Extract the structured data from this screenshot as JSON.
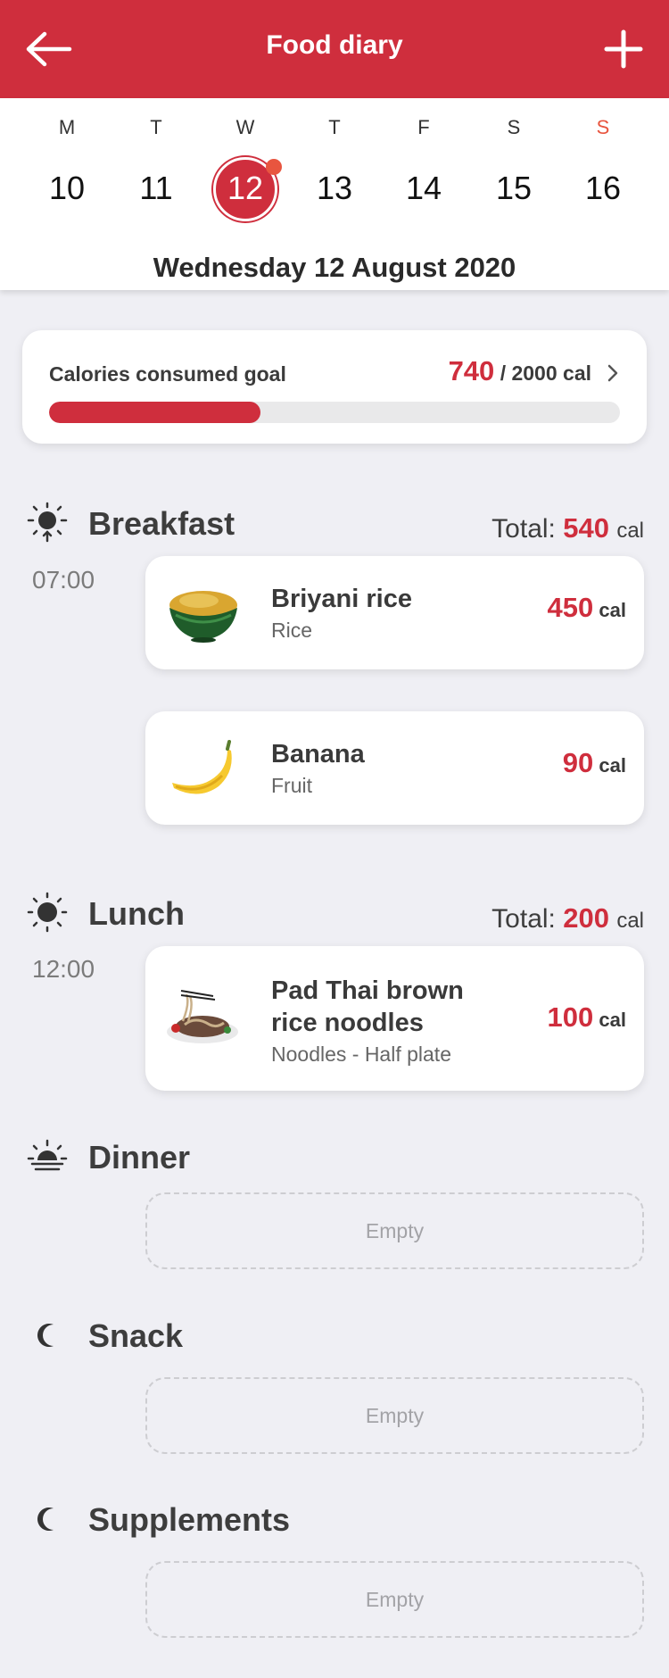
{
  "header": {
    "title": "Food diary",
    "back_icon": "arrow-left-icon",
    "add_icon": "plus-icon"
  },
  "calendar": {
    "days": [
      {
        "weekday": "M",
        "date": "10"
      },
      {
        "weekday": "T",
        "date": "11"
      },
      {
        "weekday": "W",
        "date": "12"
      },
      {
        "weekday": "T",
        "date": "13"
      },
      {
        "weekday": "F",
        "date": "14"
      },
      {
        "weekday": "S",
        "date": "15"
      },
      {
        "weekday": "S",
        "date": "16"
      }
    ],
    "selected_date": "12",
    "full_date": "Wednesday 12 August 2020"
  },
  "goal": {
    "label": "Calories consumed goal",
    "consumed": "740",
    "target_text": "/ 2000 cal",
    "progress_fraction": 0.37
  },
  "meals": {
    "breakfast": {
      "title": "Breakfast",
      "total_label": "Total:",
      "total_value": "540",
      "unit": "cal",
      "time": "07:00",
      "items": [
        {
          "name": "Briyani rice",
          "category": "Rice",
          "calories": "450",
          "unit": "cal"
        },
        {
          "name": "Banana",
          "category": "Fruit",
          "calories": "90",
          "unit": "cal"
        }
      ]
    },
    "lunch": {
      "title": "Lunch",
      "total_label": "Total:",
      "total_value": "200",
      "unit": "cal",
      "time": "12:00",
      "items": [
        {
          "name_line1": "Pad Thai brown",
          "name_line2": "rice noodles",
          "category": "Noodles - Half plate",
          "calories": "100",
          "unit": "cal"
        }
      ]
    },
    "dinner": {
      "title": "Dinner",
      "empty_text": "Empty"
    },
    "snack": {
      "title": "Snack",
      "empty_text": "Empty"
    },
    "supplements": {
      "title": "Supplements",
      "empty_text": "Empty"
    }
  },
  "colors": {
    "brand": "#cf2e3d",
    "sunday": "#e8553f",
    "background": "#efeff4"
  }
}
